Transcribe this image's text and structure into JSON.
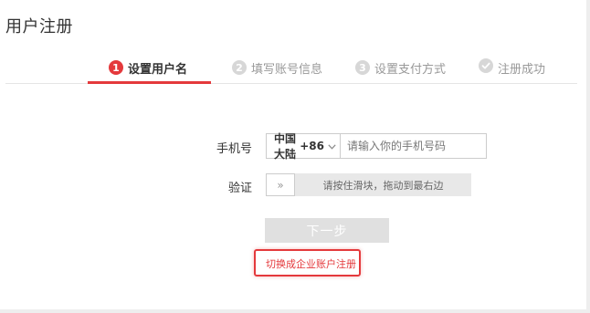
{
  "page": {
    "title": "用户注册"
  },
  "steps": [
    {
      "number": "1",
      "label": "设置用户名",
      "state": "active"
    },
    {
      "number": "2",
      "label": "填写账号信息",
      "state": "pending"
    },
    {
      "number": "3",
      "label": "设置支付方式",
      "state": "pending"
    },
    {
      "icon": "check-circle-icon",
      "label": "注册成功",
      "state": "pending"
    }
  ],
  "form": {
    "phone_label": "手机号",
    "region_name": "中国大陆",
    "region_code": "+86",
    "phone_placeholder": "请输入你的手机号码",
    "verify_label": "验证",
    "slider_handle": "»",
    "slider_text": "请按住滑块，拖动到最右边",
    "next_label": "下一步",
    "switch_link": "切换成企业账户注册"
  },
  "colors": {
    "accent": "#e4393c",
    "step_inactive": "#d7d7d7",
    "button_disabled": "#e0e0e0"
  }
}
